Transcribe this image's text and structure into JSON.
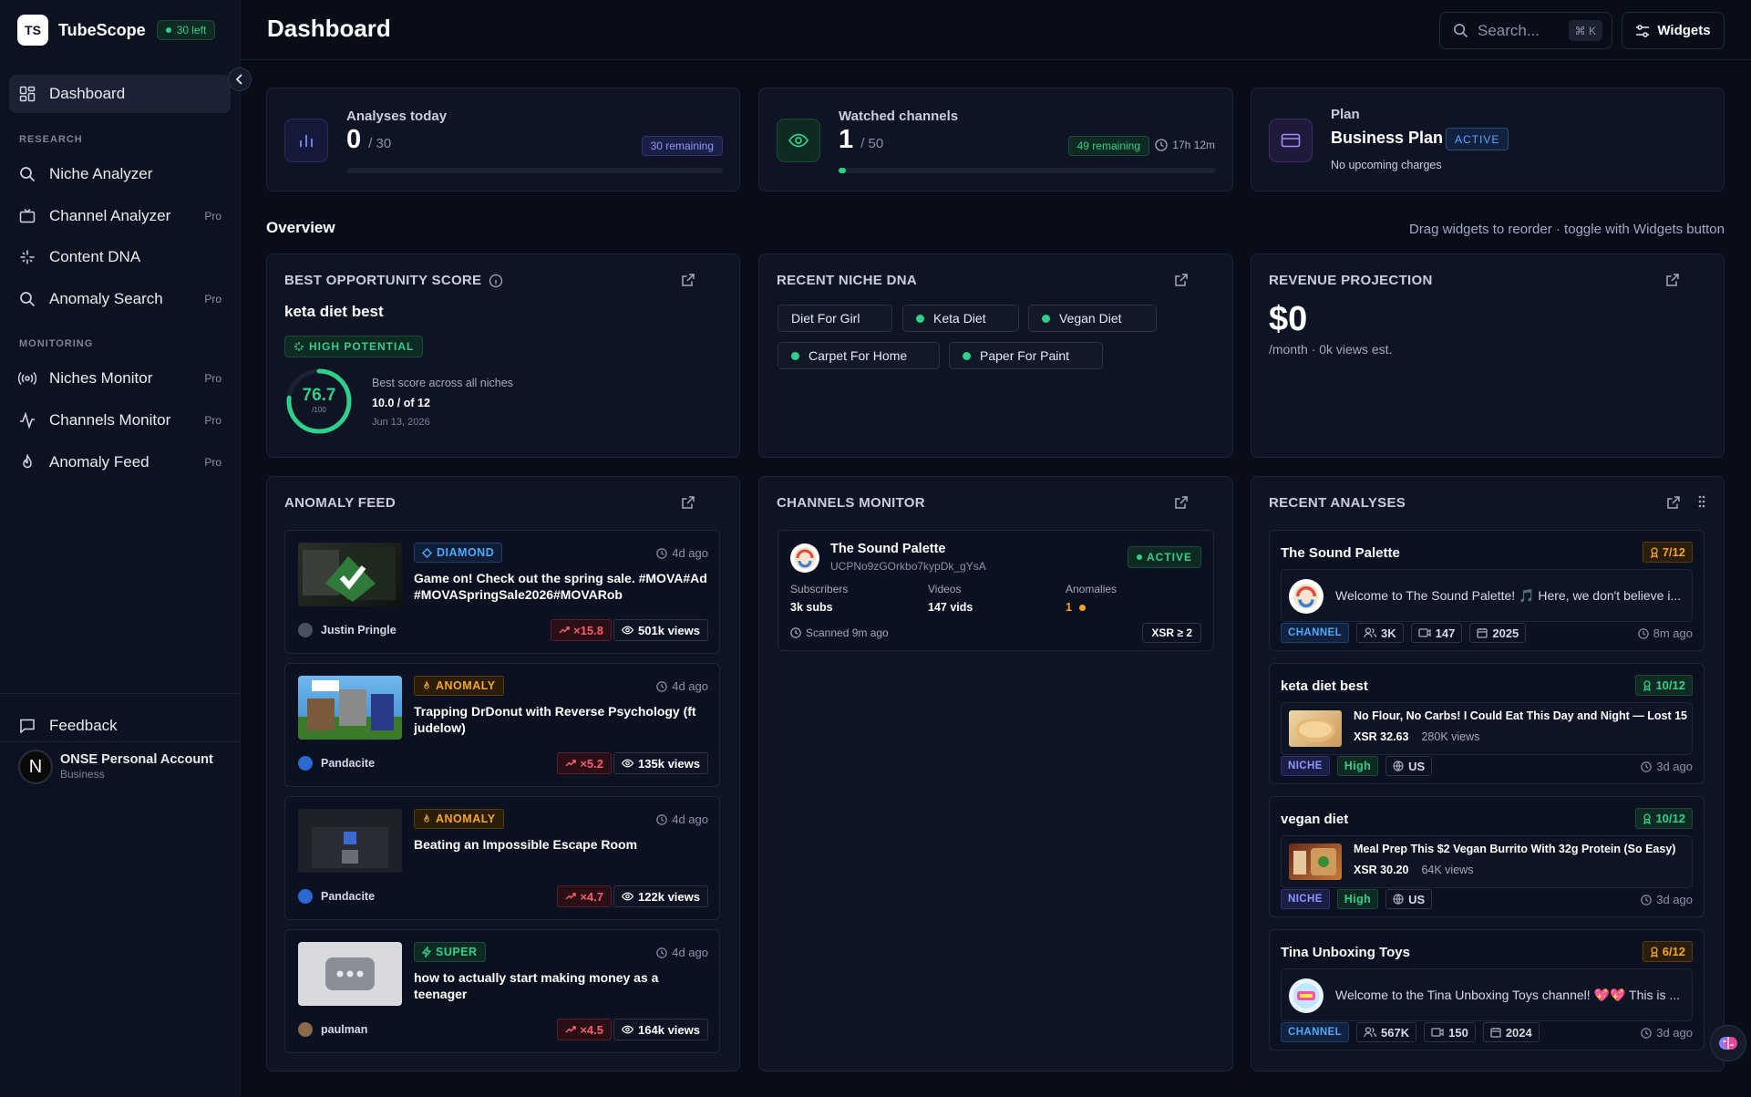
{
  "app": {
    "logo_initials": "TS",
    "name": "TubeScope",
    "credits_badge": "30 left"
  },
  "sidebar": {
    "dashboard": "Dashboard",
    "research_heading": "RESEARCH",
    "research_items": [
      {
        "label": "Niche Analyzer",
        "pro": ""
      },
      {
        "label": "Channel Analyzer",
        "pro": "Pro"
      },
      {
        "label": "Content DNA",
        "pro": ""
      },
      {
        "label": "Anomaly Search",
        "pro": "Pro"
      }
    ],
    "monitoring_heading": "MONITORING",
    "monitoring_items": [
      {
        "label": "Niches Monitor",
        "pro": "Pro"
      },
      {
        "label": "Channels Monitor",
        "pro": "Pro"
      },
      {
        "label": "Anomaly Feed",
        "pro": "Pro"
      }
    ],
    "feedback": "Feedback",
    "account": {
      "avatar_letter": "N",
      "name": "ONSE Personal Account",
      "plan": "Business"
    }
  },
  "header": {
    "title": "Dashboard",
    "search_placeholder": "Search...",
    "search_shortcut": "⌘ K",
    "widgets_button": "Widgets"
  },
  "stats": {
    "analyses": {
      "label": "Analyses today",
      "value": "0",
      "total": "/ 30",
      "remaining": "30 remaining",
      "progress": 0
    },
    "watched": {
      "label": "Watched channels",
      "value": "1",
      "total": "/ 50",
      "remaining": "49 remaining",
      "timer": "17h 12m",
      "progress": 0.02
    },
    "plan": {
      "label": "Plan",
      "name": "Business Plan",
      "status": "ACTIVE",
      "note": "No upcoming charges"
    }
  },
  "overview": {
    "title": "Overview",
    "hint": "Drag widgets to reorder · toggle with Widgets button"
  },
  "opportunity": {
    "title": "BEST OPPORTUNITY SCORE",
    "keyword": "keta diet best",
    "badge": "HIGH POTENTIAL",
    "score": "76.7",
    "score_max": "/100",
    "score_fraction": 0.767,
    "desc": "Best score across all niches",
    "detail": "10.0 / of 12",
    "date": "Jun 13, 2026"
  },
  "niche_dna": {
    "title": "RECENT NICHE DNA",
    "tags": [
      {
        "label": "Diet For Girl",
        "dot": false
      },
      {
        "label": "Keta Diet",
        "dot": true
      },
      {
        "label": "Vegan Diet",
        "dot": true
      },
      {
        "label": "Carpet For Home",
        "dot": true
      },
      {
        "label": "Paper For Paint",
        "dot": true
      }
    ]
  },
  "revenue": {
    "title": "REVENUE PROJECTION",
    "value": "$0",
    "sub": "/month · 0k views est."
  },
  "anomaly_feed": {
    "title": "ANOMALY FEED",
    "items": [
      {
        "badge": "DIAMOND",
        "badge_type": "diamond",
        "time": "4d ago",
        "title": "Game on! Check out the spring sale. #MOVA#Ad#MOVASpringSale2026#MOVARob",
        "author": "Justin Pringle",
        "multiplier": "×15.8",
        "views": "501k views"
      },
      {
        "badge": "ANOMALY",
        "badge_type": "anomaly",
        "time": "4d ago",
        "title": "Trapping DrDonut with Reverse Psychology (ft judelow)",
        "author": "Pandacite",
        "multiplier": "×5.2",
        "views": "135k views"
      },
      {
        "badge": "ANOMALY",
        "badge_type": "anomaly",
        "time": "4d ago",
        "title": "Beating an Impossible Escape Room",
        "author": "Pandacite",
        "multiplier": "×4.7",
        "views": "122k views"
      },
      {
        "badge": "SUPER",
        "badge_type": "super",
        "time": "4d ago",
        "title": "how to actually start making money as a teenager",
        "author": "paulman",
        "multiplier": "×4.5",
        "views": "164k views"
      }
    ]
  },
  "channels_monitor": {
    "title": "CHANNELS MONITOR",
    "channel": {
      "name": "The Sound Palette",
      "id": "UCPNo9zGOrkbo7kypDk_gYsA",
      "status": "ACTIVE",
      "subscribers_label": "Subscribers",
      "subscribers": "3k subs",
      "videos_label": "Videos",
      "videos": "147 vids",
      "anomalies_label": "Anomalies",
      "anomalies": "1",
      "scanned": "Scanned 9m ago",
      "xsr": "XSR ≥ 2"
    }
  },
  "recent_analyses": {
    "title": "RECENT ANALYSES",
    "items": [
      {
        "name": "The Sound Palette",
        "score": "7/12",
        "score_color": "amber",
        "kind": "channel",
        "text": "Welcome to The Sound Palette! 🎵 Here, we don't believe i...",
        "type": "CHANNEL",
        "chips": [
          "3K",
          "147",
          "2025"
        ],
        "time": "8m ago"
      },
      {
        "name": "keta diet best",
        "score": "10/12",
        "score_color": "green",
        "kind": "niche",
        "text": "No Flour, No Carbs! I Could Eat This Day and Night — Lost 15 ...",
        "xsr": "XSR 32.63",
        "views": "280K views",
        "type": "NICHE",
        "level": "High",
        "region": "US",
        "time": "3d ago"
      },
      {
        "name": "vegan diet",
        "score": "10/12",
        "score_color": "green",
        "kind": "niche",
        "text": "Meal Prep This $2 Vegan Burrito With 32g Protein (So Easy)",
        "xsr": "XSR 30.20",
        "views": "64K views",
        "type": "NICHE",
        "level": "High",
        "region": "US",
        "time": "3d ago"
      },
      {
        "name": "Tina Unboxing Toys",
        "score": "6/12",
        "score_color": "amber",
        "kind": "channel",
        "text": "Welcome to the Tina Unboxing Toys channel! 💖💖 This is ...",
        "type": "CHANNEL",
        "chips": [
          "567K",
          "150",
          "2024"
        ],
        "time": "3d ago"
      }
    ]
  },
  "colors": {
    "accent_green": "#2fd08a",
    "accent_amber": "#f5a524",
    "accent_red": "#ff5a6e",
    "accent_blue": "#3b9cff",
    "accent_purple": "#8b7cf6"
  }
}
